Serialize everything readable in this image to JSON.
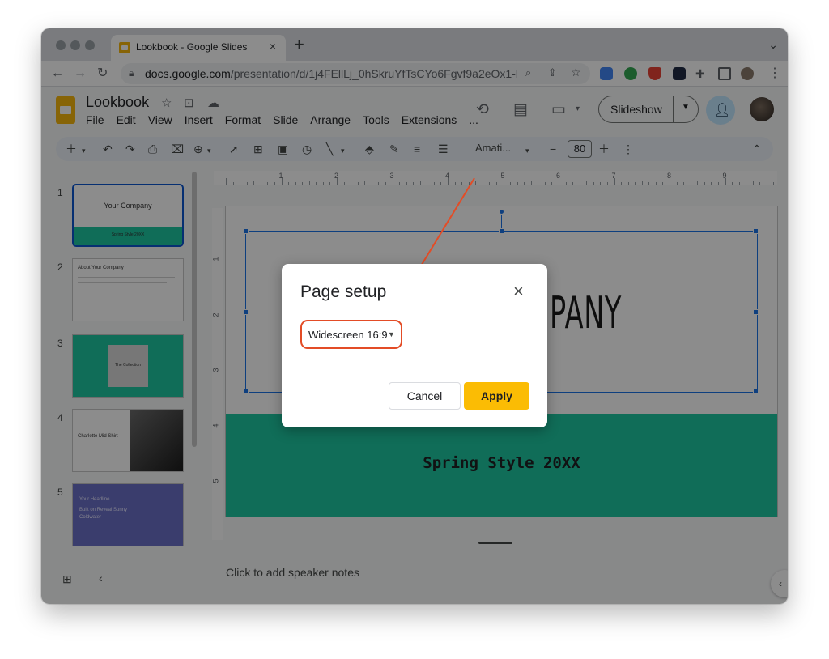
{
  "browser": {
    "tab_title": "Lookbook - Google Slides",
    "new_tab": "+",
    "close_tab": "×",
    "url_domain": "docs.google.com",
    "url_path": "/presentation/d/1j4FEllLj_0hSkruYfTsCYo6Fgvf9a2eOx1-lc..."
  },
  "app": {
    "doc_title": "Lookbook",
    "menu": [
      "File",
      "Edit",
      "View",
      "Insert",
      "Format",
      "Slide",
      "Arrange",
      "Tools",
      "Extensions",
      "..."
    ],
    "slideshow_label": "Slideshow",
    "font_name": "Amati...",
    "font_size": "80"
  },
  "filmstrip": {
    "slides": [
      {
        "num": "1",
        "title": "Your Company",
        "subtitle": "Spring Style 20XX"
      },
      {
        "num": "2",
        "title": "About Your Company"
      },
      {
        "num": "3",
        "title": "The Collection"
      },
      {
        "num": "4",
        "title": "Charlotte Mid Shirt"
      },
      {
        "num": "5",
        "title": "Your Headline",
        "body": "Built on Reveal Sunny Coldwater"
      }
    ]
  },
  "ruler": {
    "top": [
      "1",
      "2",
      "3",
      "4",
      "5",
      "6",
      "7",
      "8",
      "9"
    ],
    "left": [
      "1",
      "2",
      "3",
      "4",
      "5"
    ]
  },
  "slide": {
    "title_visible": "PANY",
    "band_text": "Spring Style 20XX",
    "band_color": "#1ec6a0"
  },
  "notes": {
    "placeholder": "Click to add speaker notes"
  },
  "dialog": {
    "title": "Page setup",
    "close": "×",
    "selected_option": "Widescreen 16:9",
    "cancel_label": "Cancel",
    "apply_label": "Apply",
    "apply_color": "#fbbc04",
    "highlight_color": "#e34c26"
  }
}
